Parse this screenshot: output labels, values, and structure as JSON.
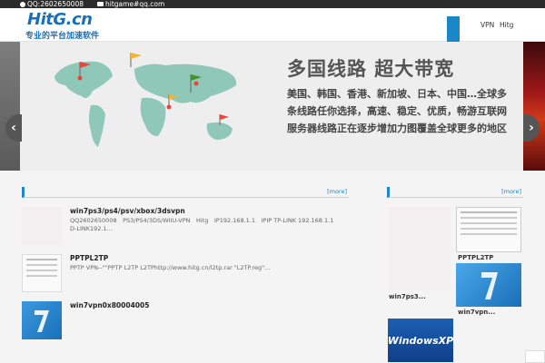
{
  "topbar": {
    "qq": "QQ:2602650008",
    "email": "hitgame#qq.com"
  },
  "header": {
    "logo": "HitG.cn",
    "slogan": "专业的平台加速软件",
    "nav": [
      {
        "label": "VPN"
      },
      {
        "label": "Hitg"
      }
    ]
  },
  "banner": {
    "headline": "多国线路 超大带宽",
    "description": "美国、韩国、香港、新加坡、日本、中国…全球多条线路任你选择，高速、稳定、优质，畅游互联网 服务器线路正在逐步增加力图覆盖全球更多的地区"
  },
  "left_panel": {
    "more": "[more]",
    "articles": [
      {
        "title": "win7ps3/ps4/psv/xbox/3dsvpn",
        "text": "QQ2602650008　PS3/PS4/3DS/WIIU-VPN　Hitg　IP192.168.1.1　IPIP TP-LINK 192.168.1.1　D-LINK192.1…"
      },
      {
        "title": "PPTPL2TP",
        "text": "PPTP VPN--\"\"PPTP L2TP L2TPhttp://www.hitg.cn/l2tp.rar \"L2TP.reg\"…"
      },
      {
        "title": "win7vpn0x80004005",
        "text": ""
      }
    ]
  },
  "right_panel": {
    "more": "[more]",
    "items": [
      {
        "label": "win7ps3..."
      },
      {
        "label": "PPTPL2TP"
      },
      {
        "label": "win7vpn..."
      },
      {
        "label": "WindowsXP"
      }
    ]
  },
  "colors": {
    "brand": "#1a6fb8",
    "accent": "#1b87c9",
    "map": "#8fc7b8"
  }
}
